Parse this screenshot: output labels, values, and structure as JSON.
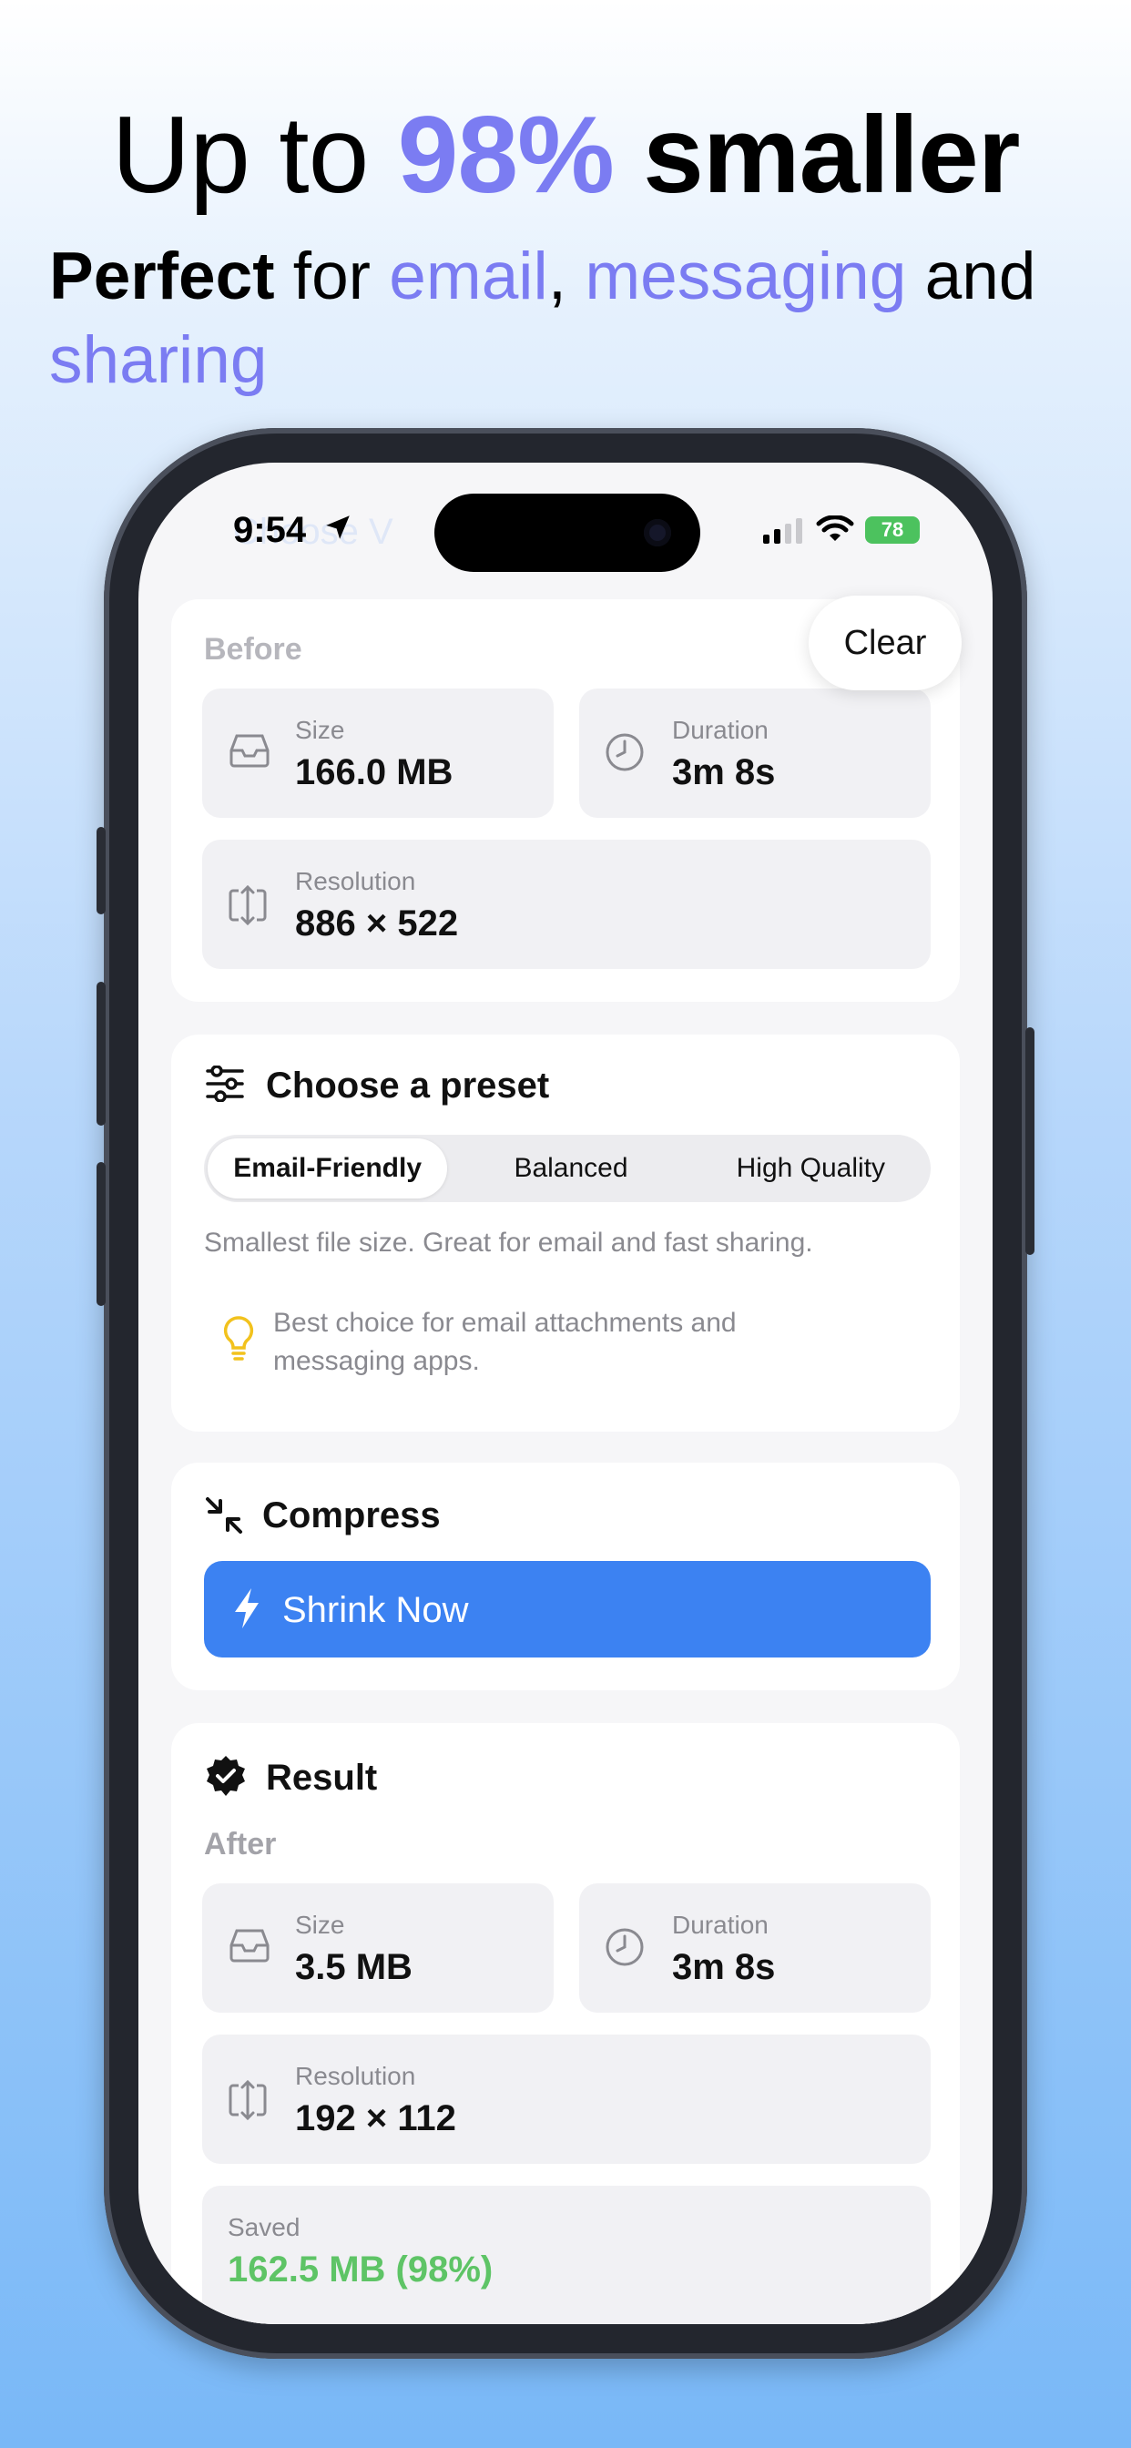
{
  "headline": {
    "pre": "Up to ",
    "accent": "98%",
    "post": " smaller"
  },
  "subline": {
    "strong": "Perfect",
    "t1": " for ",
    "a1": "email",
    "t2": ", ",
    "a2": "messaging",
    "t3": " and ",
    "a3": "sharing"
  },
  "status": {
    "time": "9:54",
    "ghost": "Choose V",
    "battery": "78"
  },
  "clear_label": "Clear",
  "before": {
    "label": "Before",
    "size_label": "Size",
    "size_value": "166.0 MB",
    "duration_label": "Duration",
    "duration_value": "3m 8s",
    "resolution_label": "Resolution",
    "resolution_value": "886 × 522"
  },
  "preset": {
    "title": "Choose a preset",
    "options": [
      "Email-Friendly",
      "Balanced",
      "High Quality"
    ],
    "selected": "Email-Friendly",
    "description": "Smallest file size. Great for email and fast sharing.",
    "tip": "Best choice for email attachments and messaging apps."
  },
  "compress": {
    "title": "Compress",
    "button": "Shrink Now"
  },
  "result": {
    "title": "Result",
    "label": "After",
    "size_label": "Size",
    "size_value": "3.5 MB",
    "duration_label": "Duration",
    "duration_value": "3m 8s",
    "resolution_label": "Resolution",
    "resolution_value": "192 × 112",
    "saved_label": "Saved",
    "saved_value": "162.5 MB (98%)"
  },
  "colors": {
    "accent": "#7b7cf2",
    "primary": "#3c82f2",
    "success": "#5ec466"
  }
}
